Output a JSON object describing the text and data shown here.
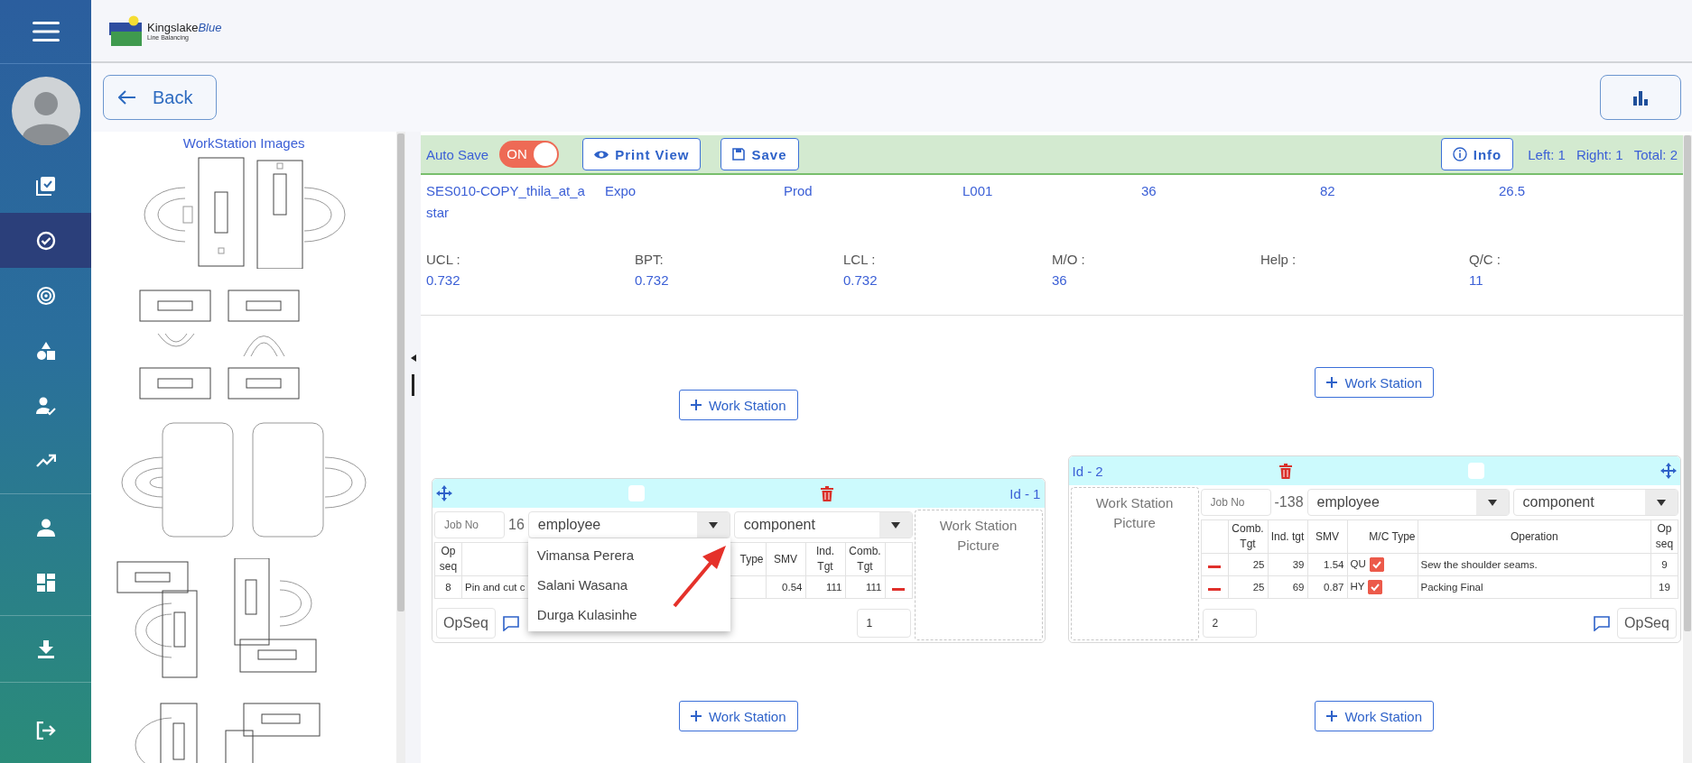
{
  "sidebar": {
    "groups": [
      {
        "items": [
          {
            "selected": false
          },
          {
            "selected": true
          },
          {
            "selected": false
          },
          {
            "selected": false
          },
          {
            "selected": false
          },
          {
            "selected": false
          }
        ]
      },
      {
        "items": [
          {
            "selected": false
          },
          {
            "selected": false
          }
        ]
      },
      {
        "items": [
          {
            "selected": false
          }
        ]
      },
      {
        "items": [
          {
            "selected": false
          }
        ]
      }
    ]
  },
  "header": {
    "brand": "Kingslake",
    "brand_accent": "Blue",
    "subtitle": "Line Balancing"
  },
  "toolbar": {
    "back": "Back"
  },
  "images_panel": {
    "title": "WorkStation Images"
  },
  "action_bar": {
    "auto_save_label": "Auto Save",
    "auto_save": {
      "on": true,
      "label": "ON"
    },
    "buttons": [
      {
        "label": "Print View",
        "kind": "eye"
      },
      {
        "label": "Save",
        "kind": "disk"
      }
    ],
    "info": "Info",
    "counts": [
      "Left: 1",
      "Right: 1",
      "Total: 2"
    ]
  },
  "style_info": {
    "values": [
      "SES010-COPY_thila_at_astar",
      "Expo",
      "Prod",
      "L001",
      "36",
      "82",
      "26.5"
    ],
    "stats": [
      {
        "label": "UCL :",
        "value": "0.732"
      },
      {
        "label": "BPT:",
        "value": "0.732"
      },
      {
        "label": "LCL :",
        "value": "0.732"
      },
      {
        "label": "M/O :",
        "value": "36"
      },
      {
        "label": "Help :"
      },
      {
        "label": "Q/C :",
        "value": "11"
      }
    ]
  },
  "lanes": [
    {
      "add_top": "Work Station",
      "add_bottom": "Work Station",
      "card": {
        "id_label": "Id - 1",
        "kind": "picture-right",
        "checked": false,
        "job_no": {
          "placeholder": "Job No"
        },
        "job_suffix": "16",
        "employee": {
          "value": "employee",
          "open": true,
          "options": [
            "Vimansa Perera",
            "Salani Wasana",
            "Durga Kulasinhe"
          ]
        },
        "component": {
          "value": "component"
        },
        "columns": [
          {
            "kind": "seq",
            "label": "Op seq"
          },
          {
            "kind": "text"
          },
          {
            "kind": "mc",
            "label": "Type"
          },
          {
            "kind": "num",
            "label": "SMV"
          },
          {
            "kind": "num",
            "label": "Ind. Tgt"
          },
          {
            "kind": "num",
            "label": "Comb. Tgt"
          },
          {
            "kind": "remove"
          }
        ],
        "rows": [
          {
            "cells": [
              {
                "text": "8"
              },
              {
                "text": "Pin and cut c"
              },
              {},
              {
                "text": "0.54"
              },
              {
                "text": "111"
              },
              {
                "text": "111"
              },
              {}
            ]
          }
        ],
        "count": "1",
        "opseq": "OpSeq",
        "picture_label": "Work Station Picture"
      }
    },
    {
      "add_top": "Work Station",
      "add_bottom": "Work Station",
      "card": {
        "id_label": "Id - 2",
        "kind": "picture-left",
        "checked": false,
        "job_no": {
          "placeholder": "Job No"
        },
        "job_suffix": "-138",
        "employee": {
          "value": "employee",
          "open": false
        },
        "component": {
          "value": "component"
        },
        "columns": [
          {
            "kind": "remove"
          },
          {
            "kind": "num",
            "label": "Comb. Tgt"
          },
          {
            "kind": "num",
            "label": "Ind. tgt"
          },
          {
            "kind": "num",
            "label": "SMV"
          },
          {
            "kind": "mc",
            "label": "M/C Type"
          },
          {
            "kind": "text",
            "label": "Operation"
          },
          {
            "kind": "seq",
            "label": "Op seq"
          }
        ],
        "rows": [
          {
            "cells": [
              {},
              {
                "text": "25"
              },
              {
                "text": "39"
              },
              {
                "text": "1.54"
              },
              {
                "text": "QU",
                "checked": true
              },
              {
                "text": "Sew the shoulder seams."
              },
              {
                "text": "9"
              }
            ]
          },
          {
            "cells": [
              {},
              {
                "text": "25"
              },
              {
                "text": "69"
              },
              {
                "text": "0.87"
              },
              {
                "text": "HY",
                "checked": true
              },
              {
                "text": "Packing Final"
              },
              {
                "text": "19"
              }
            ]
          }
        ],
        "count": "2",
        "opseq": "OpSeq",
        "picture_label": "Work Station Picture"
      }
    }
  ]
}
